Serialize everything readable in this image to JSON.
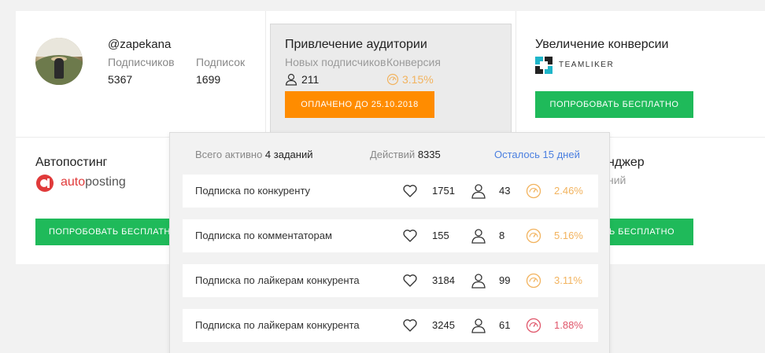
{
  "profile": {
    "username": "@zapekana",
    "followers_label": "Подписчиков",
    "followers_value": "5367",
    "following_label": "Подписок",
    "following_value": "1699"
  },
  "audience": {
    "title": "Привлечение аудитории",
    "new_followers_label": "Новых подписчиков",
    "conversion_label": "Конверсия",
    "new_followers_value": "211",
    "conversion_value": "3.15%",
    "paid_button": "ОПЛАЧЕНО ДО 25.10.2018"
  },
  "conversion": {
    "title": "Увеличение конверсии",
    "logo_text": "TEAMLIKER",
    "button": "ПОПРОБОВАТЬ БЕСПЛАТНО"
  },
  "autoposting": {
    "title": "Автопостинг",
    "logo_prefix": "auto",
    "logo_suffix": "posting",
    "button": "ПОПРОБОВАТЬ БЕСПЛАТНО"
  },
  "messenger": {
    "title_partial": "нджер",
    "sub_partial": "ний",
    "button_partial": "Ь БЕСПЛАТНО"
  },
  "tasks_dropdown": {
    "total_label": "Всего активно",
    "total_value": "4 заданий",
    "actions_label": "Действий",
    "actions_value": "8335",
    "remaining_link": "Осталось 15 дней",
    "rows": [
      {
        "name": "Подписка по конкуренту",
        "likes": "1751",
        "users": "43",
        "conversion": "2.46%",
        "level": "medium"
      },
      {
        "name": "Подписка по комментаторам",
        "likes": "155",
        "users": "8",
        "conversion": "5.16%",
        "level": "medium"
      },
      {
        "name": "Подписка по лайкерам конкурента",
        "likes": "3184",
        "users": "99",
        "conversion": "3.11%",
        "level": "medium"
      },
      {
        "name": "Подписка по лайкерам конкурента",
        "likes": "3245",
        "users": "61",
        "conversion": "1.88%",
        "level": "low"
      }
    ]
  },
  "colors": {
    "orange": "#ff8c00",
    "green": "#1fba5a",
    "link_blue": "#4a7fe0",
    "pct_medium": "#f2b35e",
    "pct_low": "#e0566a"
  },
  "icons": {
    "heart": "heart-icon",
    "user": "user-icon",
    "gauge": "gauge-icon"
  }
}
